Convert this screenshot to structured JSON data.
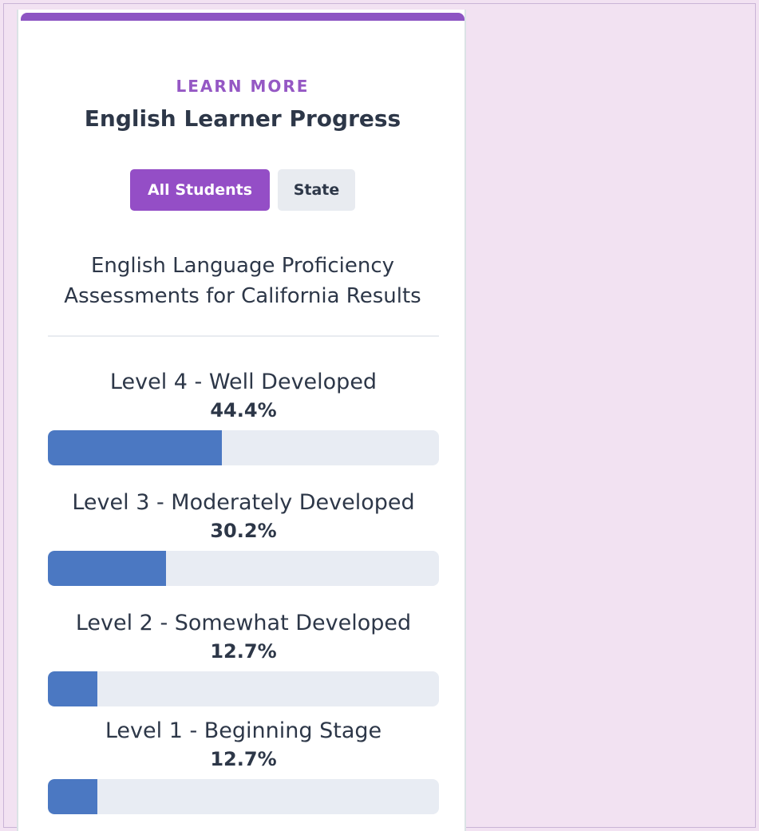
{
  "card": {
    "eyebrow": "LEARN MORE",
    "title": "English Learner Progress",
    "subtitle_line1": "English Language Proficiency",
    "subtitle_line2": "Assessments for California Results"
  },
  "toggles": [
    {
      "label": "All Students",
      "active": true
    },
    {
      "label": "State",
      "active": false
    }
  ],
  "levels": [
    {
      "label": "Level 4 - Well Developed",
      "value": "44.4%",
      "percent": 44.4
    },
    {
      "label": "Level 3 - Moderately Developed",
      "value": "30.2%",
      "percent": 30.2
    },
    {
      "label": "Level 2 - Somewhat Developed",
      "value": "12.7%",
      "percent": 12.7
    },
    {
      "label": "Level 1 - Beginning Stage",
      "value": "12.7%",
      "percent": 12.7
    }
  ],
  "colors": {
    "accent": "#8d55c3",
    "bar_fill": "#4b78c2",
    "bar_track": "#e8ecf3",
    "page_background": "#f2e2f2"
  }
}
